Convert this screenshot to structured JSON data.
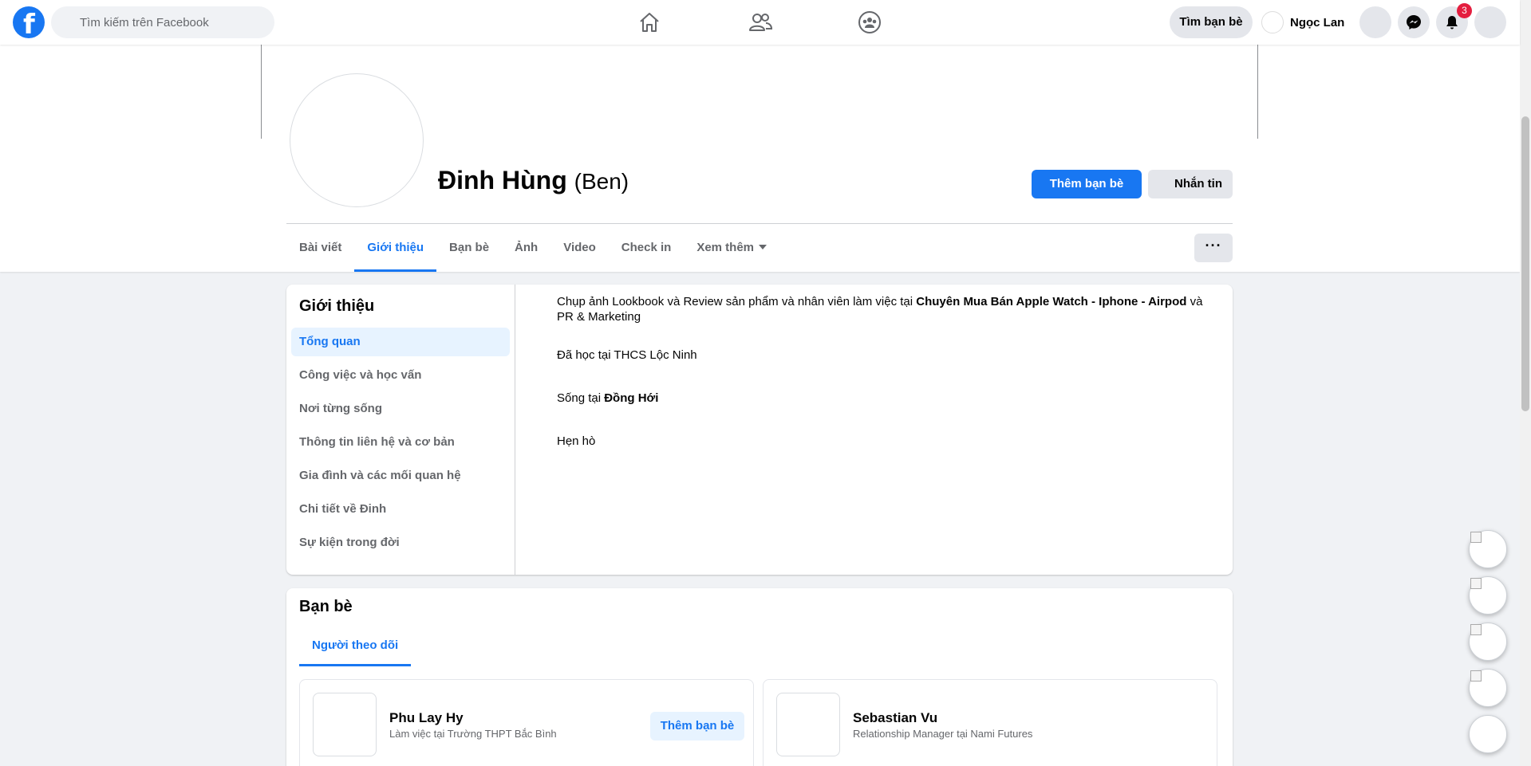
{
  "topbar": {
    "search_placeholder": "Tìm kiếm trên Facebook",
    "find_friends_label": "Tìm bạn bè",
    "user_name": "Ngọc Lan",
    "notifications_count": "3"
  },
  "profile": {
    "name": "Đinh Hùng",
    "nickname": "(Ben)",
    "add_friend_label": "Thêm bạn bè",
    "message_label": "Nhắn tin",
    "more_label": "···"
  },
  "tabs": [
    {
      "label": "Bài viết"
    },
    {
      "label": "Giới thiệu"
    },
    {
      "label": "Bạn bè"
    },
    {
      "label": "Ảnh"
    },
    {
      "label": "Video"
    },
    {
      "label": "Check in"
    },
    {
      "label": "Xem thêm"
    }
  ],
  "about": {
    "title": "Giới thiệu",
    "menu": [
      {
        "label": "Tổng quan"
      },
      {
        "label": "Công việc và học vấn"
      },
      {
        "label": "Nơi từng sống"
      },
      {
        "label": "Thông tin liên hệ và cơ bản"
      },
      {
        "label": "Gia đình và các mối quan hệ"
      },
      {
        "label": "Chi tiết về Đinh"
      },
      {
        "label": "Sự kiện trong đời"
      }
    ],
    "work_prefix": "Chụp ảnh Lookbook và Review sản phẩm và nhân viên làm việc tại ",
    "work_place": "Chuyên Mua Bán Apple Watch - Iphone - Airpod",
    "work_and": " và",
    "work_line2": "PR & Marketing",
    "education": "Đã học tại THCS Lộc Ninh",
    "lives_prefix": "Sống tại ",
    "lives_place": "Đồng Hới",
    "relationship": "Hẹn hò"
  },
  "friends": {
    "title": "Bạn bè",
    "tab_label": "Người theo dõi",
    "items": [
      {
        "name": "Phu Lay Hy",
        "subtitle": "Làm việc tại Trường THPT Bắc Bình",
        "button": "Thêm bạn bè"
      },
      {
        "name": "Sebastian Vu",
        "subtitle": "Relationship Manager tại Nami Futures"
      }
    ]
  },
  "colors": {
    "accent": "#1877f2",
    "background": "#f0f2f5",
    "badge": "#e41e3f"
  }
}
